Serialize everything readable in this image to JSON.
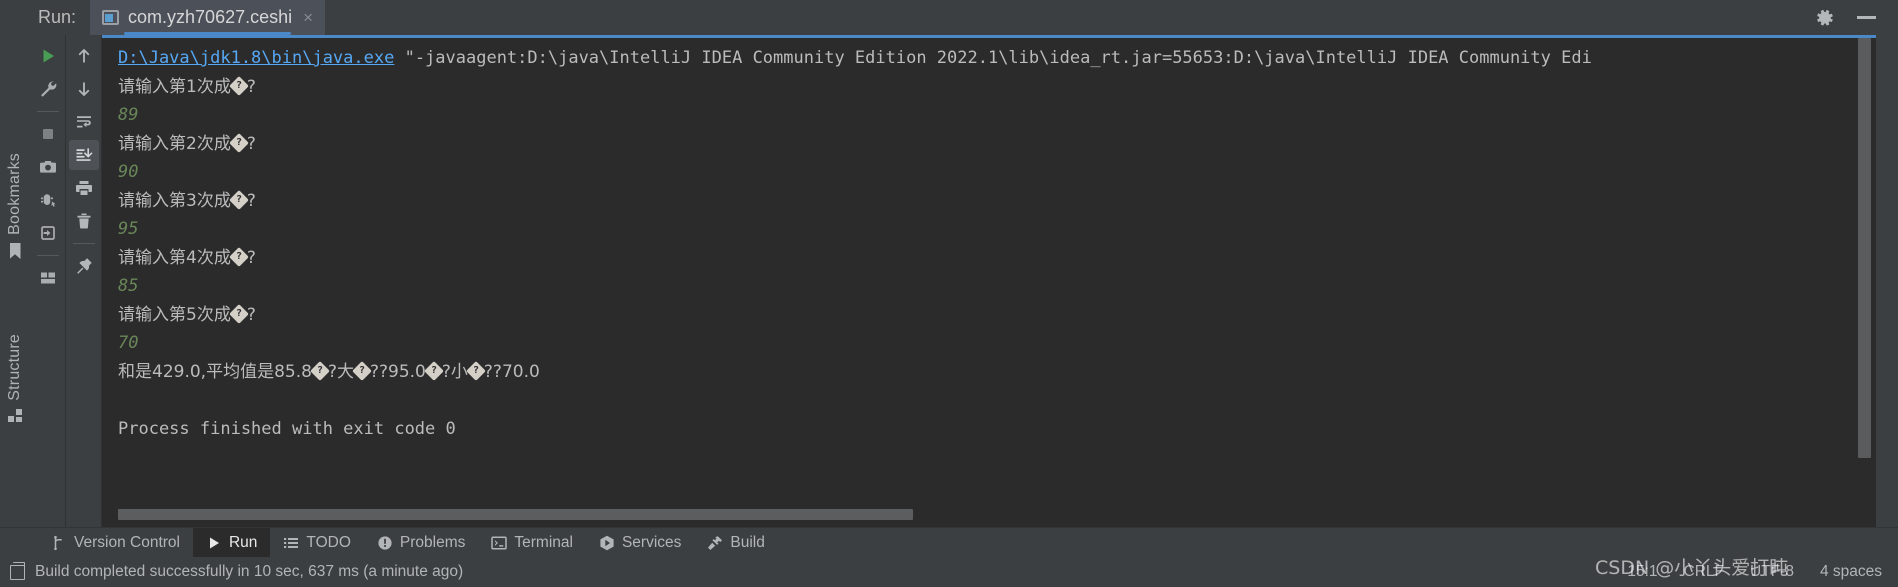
{
  "window": {
    "run_label": "Run:",
    "tab_title": "com.yzh70627.ceshi",
    "close_glyph": "×",
    "settings_icon": "gear-icon",
    "minimize_icon": "minimize-icon",
    "accent_color": "#4a88c7"
  },
  "left_stripe": {
    "bookmarks_label": "Bookmarks",
    "structure_label": "Structure"
  },
  "run_toolbar": {
    "column1": [
      {
        "name": "rerun-button",
        "icon": "play-icon",
        "tip": "Rerun"
      },
      {
        "name": "modify-run-configuration-button",
        "icon": "wrench-icon",
        "tip": "Modify Run Configuration"
      },
      {
        "name": "stop-button",
        "icon": "stop-icon",
        "tip": "Stop"
      },
      {
        "name": "screenshot-button",
        "icon": "camera-icon",
        "tip": "Screenshot"
      },
      {
        "name": "dump-threads-button",
        "icon": "thread-dump-icon",
        "tip": "Dump Threads"
      },
      {
        "name": "export-button",
        "icon": "export-icon",
        "tip": "Export"
      },
      {
        "name": "layout-button",
        "icon": "layout-icon",
        "tip": "Layout Settings"
      }
    ],
    "column2": [
      {
        "name": "up-button",
        "icon": "arrow-up-icon",
        "tip": "Up the Stack Trace"
      },
      {
        "name": "down-button",
        "icon": "arrow-down-icon",
        "tip": "Down the Stack Trace"
      },
      {
        "name": "soft-wrap-button",
        "icon": "soft-wrap-icon",
        "tip": "Soft-Wrap"
      },
      {
        "name": "scroll-to-end-button",
        "icon": "scroll-to-end-icon",
        "tip": "Scroll to the End",
        "active": true
      },
      {
        "name": "print-button",
        "icon": "print-icon",
        "tip": "Print"
      },
      {
        "name": "clear-all-button",
        "icon": "trash-icon",
        "tip": "Clear All"
      },
      {
        "name": "pin-tab-button",
        "icon": "pin-icon",
        "tip": "Pin Tab"
      }
    ]
  },
  "console": {
    "command": {
      "link": "D:\\Java\\jdk1.8\\bin\\java.exe",
      "args": " \"-javaagent:D:\\java\\IntelliJ IDEA Community Edition 2022.1\\lib\\idea_rt.jar=55653:D:\\java\\IntelliJ IDEA Community Edi"
    },
    "lines": [
      {
        "kind": "prompt",
        "prefix": "请输入第1次成",
        "suffix": "?"
      },
      {
        "kind": "input",
        "text": "89"
      },
      {
        "kind": "prompt",
        "prefix": "请输入第2次成",
        "suffix": "?"
      },
      {
        "kind": "input",
        "text": "90"
      },
      {
        "kind": "prompt",
        "prefix": "请输入第3次成",
        "suffix": "?"
      },
      {
        "kind": "input",
        "text": "95"
      },
      {
        "kind": "prompt",
        "prefix": "请输入第4次成",
        "suffix": "?"
      },
      {
        "kind": "input",
        "text": "85"
      },
      {
        "kind": "prompt",
        "prefix": "请输入第5次成",
        "suffix": "?"
      },
      {
        "kind": "input",
        "text": "70"
      }
    ],
    "summary_parts": [
      "和是429.0,平均值是85.8",
      "?大",
      "??95.0",
      "?小",
      "??70.0"
    ],
    "summary_raw": "和是429.0,平均值是85.8�?大�??95.0�?小�??70.0",
    "exit_line": "Process finished with exit code 0",
    "replacement_glyph": "?",
    "input_color": "#6a8759",
    "link_color": "#56a8f5",
    "text_color": "#bbbbbb",
    "background": "#2b2b2b"
  },
  "bottom_tabs": [
    {
      "label": "Version Control",
      "icon": "branch-icon",
      "selected": false
    },
    {
      "label": "Run",
      "icon": "play-icon",
      "selected": true
    },
    {
      "label": "TODO",
      "icon": "list-icon",
      "selected": false
    },
    {
      "label": "Problems",
      "icon": "warning-icon",
      "selected": false
    },
    {
      "label": "Terminal",
      "icon": "terminal-icon",
      "selected": false
    },
    {
      "label": "Services",
      "icon": "services-icon",
      "selected": false
    },
    {
      "label": "Build",
      "icon": "hammer-icon",
      "selected": false
    }
  ],
  "status_bar": {
    "message": "Build completed successfully in 10 sec, 637 ms (a minute ago)",
    "caret_position": "15:1",
    "line_separator": "CRLF",
    "encoding": "UTF-8",
    "indent": "4 spaces",
    "watermark": "CSDN @小丫头爱打盹"
  }
}
